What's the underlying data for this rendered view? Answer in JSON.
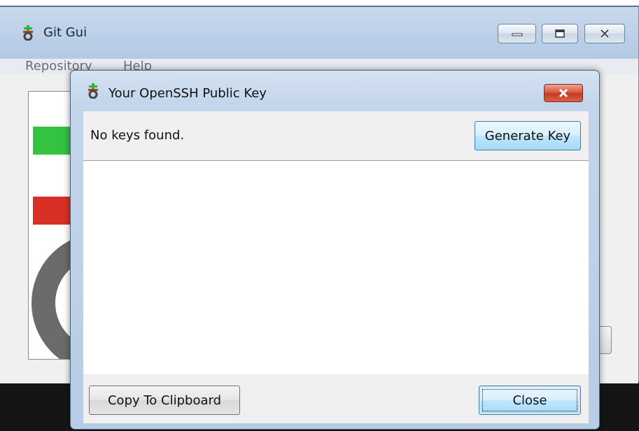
{
  "main_window": {
    "title": "Git Gui",
    "menu": [
      "Repository",
      "Help"
    ],
    "controls": {
      "minimize_icon": "minimize-icon",
      "maximize_icon": "maximize-icon",
      "close_icon": "close-icon"
    },
    "logo_colors": {
      "green": "#34c241",
      "red": "#d83025",
      "gray": "#6b6b6b"
    }
  },
  "dialog": {
    "title": "Your OpenSSH Public Key",
    "status_text": "No keys found.",
    "generate_label": "Generate Key",
    "key_text": "",
    "copy_label": "Copy To Clipboard",
    "close_label": "Close",
    "close_icon": "close-icon"
  }
}
